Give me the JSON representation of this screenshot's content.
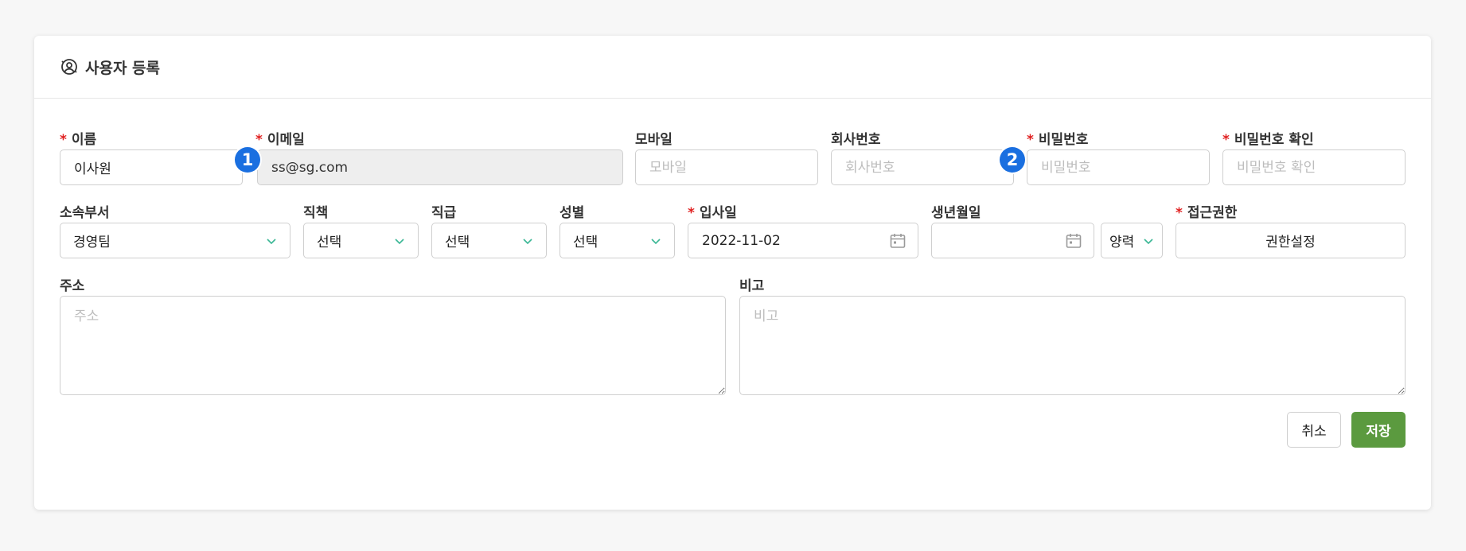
{
  "card": {
    "title": "사용자 등록",
    "icon": "user-settings-icon"
  },
  "fields": {
    "name": {
      "label": "이름",
      "required": "*",
      "value": "이사원",
      "placeholder": ""
    },
    "email": {
      "label": "이메일",
      "required": "*",
      "value": "ss@sg.com"
    },
    "mobile": {
      "label": "모바일",
      "placeholder": "모바일"
    },
    "company_no": {
      "label": "회사번호",
      "placeholder": "회사번호"
    },
    "password": {
      "label": "비밀번호",
      "required": "*",
      "placeholder": "비밀번호"
    },
    "password_confirm": {
      "label": "비밀번호 확인",
      "required": "*",
      "placeholder": "비밀번호 확인"
    },
    "department": {
      "label": "소속부서",
      "value": "경영팀"
    },
    "duty": {
      "label": "직책",
      "value": "선택"
    },
    "rank": {
      "label": "직급",
      "value": "선택"
    },
    "gender": {
      "label": "성별",
      "value": "선택"
    },
    "join_date": {
      "label": "입사일",
      "required": "*",
      "value": "2022-11-02"
    },
    "birth_date": {
      "label": "생년월일",
      "value": ""
    },
    "calendar_type": {
      "value": "양력"
    },
    "access": {
      "label": "접근권한",
      "required": "*",
      "button": "권한설정"
    },
    "address": {
      "label": "주소",
      "placeholder": "주소"
    },
    "remarks": {
      "label": "비고",
      "placeholder": "비고"
    }
  },
  "badges": {
    "one": "1",
    "two": "2"
  },
  "buttons": {
    "cancel": "취소",
    "save": "저장"
  },
  "colors": {
    "required": "#e02020",
    "save": "#5b9a3f",
    "badge": "#1a6fe0",
    "chevron": "#3ab795"
  }
}
